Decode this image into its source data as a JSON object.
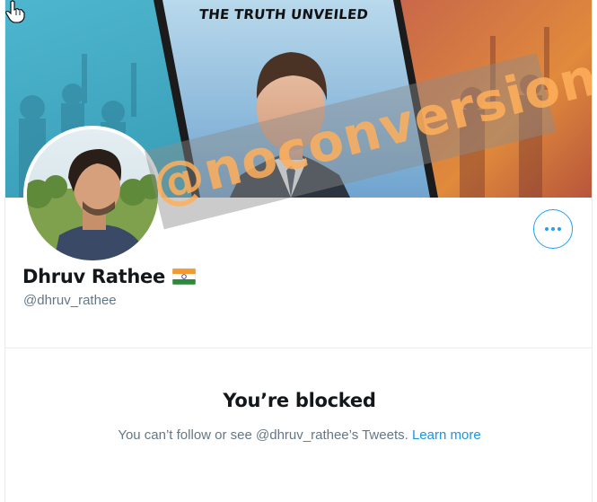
{
  "banner": {
    "title": "THE TRUTH UNVEILED"
  },
  "profile": {
    "name": "Dhruv Rathee",
    "handle": "@dhruv_rathee",
    "flag_icon": "india-flag-icon"
  },
  "actions": {
    "more_icon": "more-options-icon"
  },
  "blocked": {
    "title": "You’re blocked",
    "message": "You can’t follow or see @dhruv_rathee’s Tweets.",
    "link": "Learn more"
  },
  "watermark": {
    "text": "@noconversion"
  },
  "colors": {
    "accent": "#1da1f2",
    "text": "#14171a",
    "muted": "#657786",
    "link": "#1b95e0"
  }
}
